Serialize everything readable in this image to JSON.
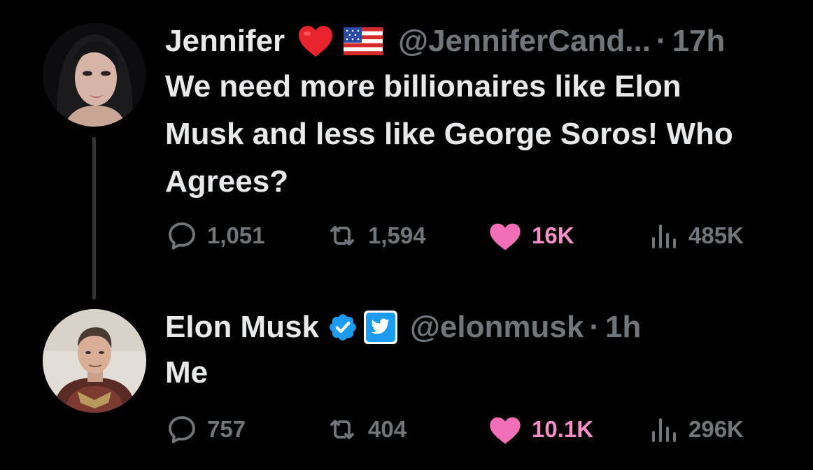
{
  "thread": {
    "tweets": [
      {
        "display_name": "Jennifer",
        "handle": "@JenniferCand...",
        "separator": "·",
        "time": "17h",
        "text": "We need more billionaires like Elon\nMusk and less like George Soros! Who\nAgrees?",
        "name_emojis": [
          "heart-emoji",
          "us-flag-emoji"
        ],
        "metrics": {
          "replies": "1,051",
          "retweets": "1,594",
          "likes": "16K",
          "views": "485K"
        }
      },
      {
        "display_name": "Elon Musk",
        "handle": "@elonmusk",
        "separator": "·",
        "time": "1h",
        "text": "Me",
        "name_badges": [
          "verified-badge-icon",
          "twitter-bird-icon"
        ],
        "metrics": {
          "replies": "757",
          "retweets": "404",
          "likes": "10.1K",
          "views": "296K"
        }
      }
    ]
  },
  "colors": {
    "background": "#000000",
    "primary_text": "#e7e9ea",
    "secondary_text": "#71767b",
    "like": "#f91880",
    "verified": "#1d9bf0",
    "thread_line": "#333639"
  }
}
